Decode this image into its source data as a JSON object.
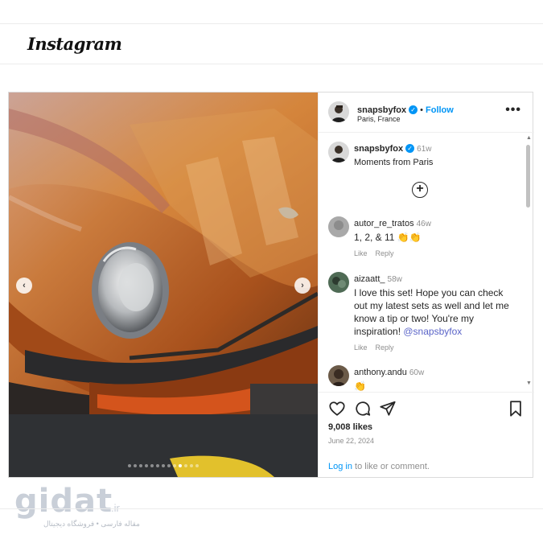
{
  "app": {
    "logo": "Instagram"
  },
  "post": {
    "author": {
      "username": "snapsbyfox",
      "follow_label": "Follow",
      "separator": "•",
      "location": "Paris, France"
    },
    "more_label": "•••",
    "carousel": {
      "slide_count": 13,
      "active_index": 9,
      "prev_label": "‹",
      "next_label": "›"
    },
    "caption": {
      "username": "snapsbyfox",
      "time": "61w",
      "text": "Moments from Paris"
    },
    "load_more_label": "+",
    "comments": [
      {
        "username": "autor_re_tratos",
        "time": "46w",
        "text": "1, 2, & 11 👏👏",
        "like_label": "Like",
        "reply_label": "Reply"
      },
      {
        "username": "aizaatt_",
        "time": "58w",
        "text": "I love this set! Hope you can check out my latest sets as well and let me know a tip or two! You're my inspiration!",
        "mention": "@snapsbyfox",
        "like_label": "Like",
        "reply_label": "Reply"
      },
      {
        "username": "anthony.andu",
        "time": "60w",
        "text": "👏"
      }
    ],
    "likes": "9,008 likes",
    "date": "June 22, 2024",
    "login_prompt": {
      "link": "Log in",
      "rest": " to like or comment."
    }
  },
  "watermark": {
    "brand": "gidat",
    "tld": ".ir",
    "tagline": "مقاله فارسی • فروشگاه دیجیتال"
  },
  "colors": {
    "accent": "#0095f6",
    "car_orange": "#c96a22",
    "verified": "#0095f6"
  }
}
